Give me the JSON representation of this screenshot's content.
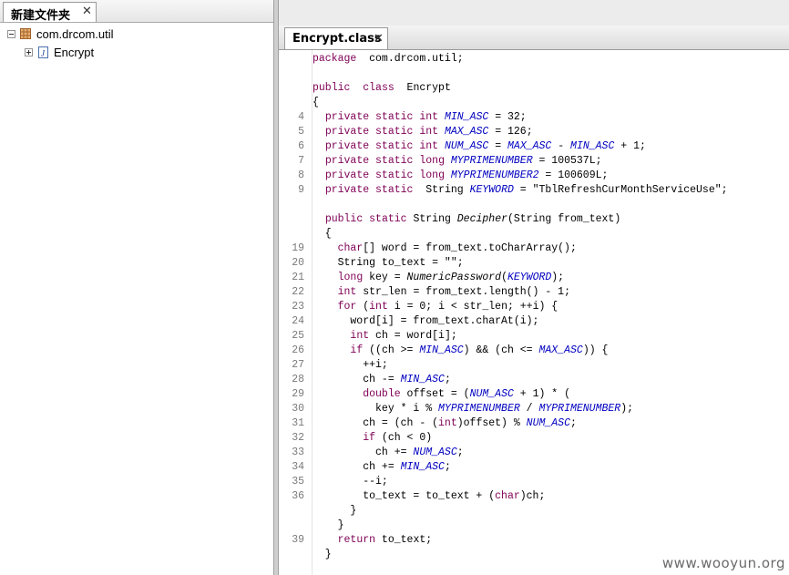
{
  "left_panel": {
    "tab_title": "新建文件夹",
    "tab_close": "✕",
    "tree": [
      {
        "label": "com.drcom.util",
        "icon": "package-icon",
        "expanded": true
      },
      {
        "label": "Encrypt",
        "icon": "java-class-icon",
        "expanded": false
      }
    ]
  },
  "editor": {
    "tab_title": "Encrypt.class",
    "tab_close": "✕",
    "lines": [
      {
        "n": "",
        "t": [
          [
            "kw",
            "package"
          ],
          [
            "",
            "  com.drcom.util;"
          ]
        ]
      },
      {
        "n": "",
        "t": []
      },
      {
        "n": "",
        "t": [
          [
            "kw",
            "public"
          ],
          [
            "",
            "  "
          ],
          [
            "kw",
            "class"
          ],
          [
            "",
            "  Encrypt"
          ]
        ]
      },
      {
        "n": "",
        "t": [
          [
            "",
            "{"
          ]
        ]
      },
      {
        "n": "4",
        "t": [
          [
            "",
            "  "
          ],
          [
            "kw",
            "private"
          ],
          [
            "",
            " "
          ],
          [
            "kw",
            "static"
          ],
          [
            "",
            " "
          ],
          [
            "kw",
            "int"
          ],
          [
            "",
            " "
          ],
          [
            "cn",
            "MIN_ASC"
          ],
          [
            "",
            " = 32;"
          ]
        ]
      },
      {
        "n": "5",
        "t": [
          [
            "",
            "  "
          ],
          [
            "kw",
            "private"
          ],
          [
            "",
            " "
          ],
          [
            "kw",
            "static"
          ],
          [
            "",
            " "
          ],
          [
            "kw",
            "int"
          ],
          [
            "",
            " "
          ],
          [
            "cn",
            "MAX_ASC"
          ],
          [
            "",
            " = 126;"
          ]
        ]
      },
      {
        "n": "6",
        "t": [
          [
            "",
            "  "
          ],
          [
            "kw",
            "private"
          ],
          [
            "",
            " "
          ],
          [
            "kw",
            "static"
          ],
          [
            "",
            " "
          ],
          [
            "kw",
            "int"
          ],
          [
            "",
            " "
          ],
          [
            "cn",
            "NUM_ASC"
          ],
          [
            "",
            " = "
          ],
          [
            "cn",
            "MAX_ASC"
          ],
          [
            "",
            " - "
          ],
          [
            "cn",
            "MIN_ASC"
          ],
          [
            "",
            " + 1;"
          ]
        ]
      },
      {
        "n": "7",
        "t": [
          [
            "",
            "  "
          ],
          [
            "kw",
            "private"
          ],
          [
            "",
            " "
          ],
          [
            "kw",
            "static"
          ],
          [
            "",
            " "
          ],
          [
            "kw",
            "long"
          ],
          [
            "",
            " "
          ],
          [
            "cn",
            "MYPRIMENUMBER"
          ],
          [
            "",
            " = 100537L;"
          ]
        ]
      },
      {
        "n": "8",
        "t": [
          [
            "",
            "  "
          ],
          [
            "kw",
            "private"
          ],
          [
            "",
            " "
          ],
          [
            "kw",
            "static"
          ],
          [
            "",
            " "
          ],
          [
            "kw",
            "long"
          ],
          [
            "",
            " "
          ],
          [
            "cn",
            "MYPRIMENUMBER2"
          ],
          [
            "",
            " = 100609L;"
          ]
        ]
      },
      {
        "n": "9",
        "t": [
          [
            "",
            "  "
          ],
          [
            "kw",
            "private"
          ],
          [
            "",
            " "
          ],
          [
            "kw",
            "static"
          ],
          [
            "",
            "",
            " "
          ],
          [
            "",
            " String "
          ],
          [
            "cn",
            "KEYWORD"
          ],
          [
            "",
            " = \"TblRefreshCurMonthServiceUse\";"
          ]
        ]
      },
      {
        "n": "",
        "t": []
      },
      {
        "n": "",
        "t": [
          [
            "",
            "  "
          ],
          [
            "kw",
            "public"
          ],
          [
            "",
            " "
          ],
          [
            "kw",
            "static"
          ],
          [
            "",
            " String "
          ],
          [
            "mt",
            "Decipher"
          ],
          [
            "",
            "(String from_text)"
          ]
        ]
      },
      {
        "n": "",
        "t": [
          [
            "",
            "  {"
          ]
        ]
      },
      {
        "n": "19",
        "t": [
          [
            "",
            "    "
          ],
          [
            "kw",
            "char"
          ],
          [
            "",
            "[] word = from_text.toCharArray();"
          ]
        ]
      },
      {
        "n": "20",
        "t": [
          [
            "",
            "    String to_text = \"\";"
          ]
        ]
      },
      {
        "n": "21",
        "t": [
          [
            "",
            "    "
          ],
          [
            "kw",
            "long"
          ],
          [
            "",
            " key = "
          ],
          [
            "mt",
            "NumericPassword"
          ],
          [
            "",
            "("
          ],
          [
            "cn",
            "KEYWORD"
          ],
          [
            "",
            ");"
          ]
        ]
      },
      {
        "n": "22",
        "t": [
          [
            "",
            "    "
          ],
          [
            "kw",
            "int"
          ],
          [
            "",
            " str_len = from_text.length() - 1;"
          ]
        ]
      },
      {
        "n": "23",
        "t": [
          [
            "",
            "    "
          ],
          [
            "kw",
            "for"
          ],
          [
            "",
            " ("
          ],
          [
            "kw",
            "int"
          ],
          [
            "",
            " i = 0; i < str_len; ++i) {"
          ]
        ]
      },
      {
        "n": "24",
        "t": [
          [
            "",
            "      word[i] = from_text.charAt(i);"
          ]
        ]
      },
      {
        "n": "25",
        "t": [
          [
            "",
            "      "
          ],
          [
            "kw",
            "int"
          ],
          [
            "",
            " ch = word[i];"
          ]
        ]
      },
      {
        "n": "26",
        "t": [
          [
            "",
            "      "
          ],
          [
            "kw",
            "if"
          ],
          [
            "",
            " ((ch >= "
          ],
          [
            "cn",
            "MIN_ASC"
          ],
          [
            "",
            ") && (ch <= "
          ],
          [
            "cn",
            "MAX_ASC"
          ],
          [
            "",
            ")) {"
          ]
        ]
      },
      {
        "n": "27",
        "t": [
          [
            "",
            "        ++i;"
          ]
        ]
      },
      {
        "n": "28",
        "t": [
          [
            "",
            "        ch -= "
          ],
          [
            "cn",
            "MIN_ASC"
          ],
          [
            "",
            ";"
          ]
        ]
      },
      {
        "n": "29",
        "t": [
          [
            "",
            "        "
          ],
          [
            "kw",
            "double"
          ],
          [
            "",
            " offset = ("
          ],
          [
            "cn",
            "NUM_ASC"
          ],
          [
            "",
            " + 1) * ("
          ]
        ]
      },
      {
        "n": "30",
        "t": [
          [
            "",
            "          key * i % "
          ],
          [
            "cn",
            "MYPRIMENUMBER"
          ],
          [
            "",
            " / "
          ],
          [
            "cn",
            "MYPRIMENUMBER"
          ],
          [
            "",
            ");"
          ]
        ]
      },
      {
        "n": "31",
        "t": [
          [
            "",
            "        ch = (ch - ("
          ],
          [
            "kw",
            "int"
          ],
          [
            "",
            ")offset) % "
          ],
          [
            "cn",
            "NUM_ASC"
          ],
          [
            "",
            ";"
          ]
        ]
      },
      {
        "n": "32",
        "t": [
          [
            "",
            "        "
          ],
          [
            "kw",
            "if"
          ],
          [
            "",
            " (ch < 0)"
          ]
        ]
      },
      {
        "n": "33",
        "t": [
          [
            "",
            "          ch += "
          ],
          [
            "cn",
            "NUM_ASC"
          ],
          [
            "",
            ";"
          ]
        ]
      },
      {
        "n": "34",
        "t": [
          [
            "",
            "        ch += "
          ],
          [
            "cn",
            "MIN_ASC"
          ],
          [
            "",
            ";"
          ]
        ]
      },
      {
        "n": "35",
        "t": [
          [
            "",
            "        --i;"
          ]
        ]
      },
      {
        "n": "36",
        "t": [
          [
            "",
            "        to_text = to_text + ("
          ],
          [
            "kw",
            "char"
          ],
          [
            "",
            ")ch;"
          ]
        ]
      },
      {
        "n": "",
        "t": [
          [
            "",
            "      }"
          ]
        ]
      },
      {
        "n": "",
        "t": [
          [
            "",
            "    }"
          ]
        ]
      },
      {
        "n": "39",
        "t": [
          [
            "",
            "    "
          ],
          [
            "kw",
            "return"
          ],
          [
            "",
            " to_text;"
          ]
        ]
      },
      {
        "n": "",
        "t": [
          [
            "",
            "  }"
          ]
        ]
      }
    ]
  },
  "watermark": "www.wooyun.org",
  "colors": {
    "keyword": "#7f0055",
    "constant": "#0000c0",
    "line_number": "#7a7a7a"
  }
}
